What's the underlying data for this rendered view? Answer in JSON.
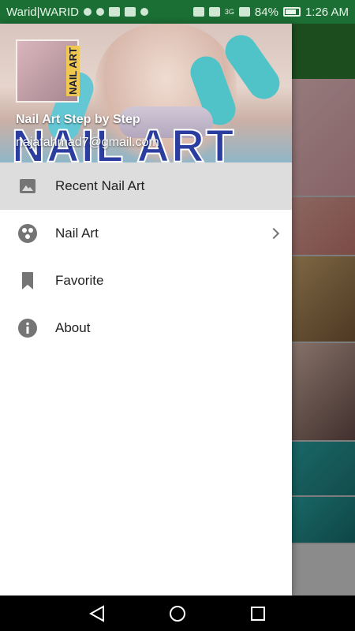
{
  "status_bar": {
    "carrier": "Warid|WARID",
    "network": "3G",
    "battery": "84%",
    "time": "1:26 AM"
  },
  "drawer": {
    "header": {
      "title": "Nail Art Step by Step",
      "email": "najafahmad7@gmail.com",
      "brand_text": "NAIL ART",
      "logo_text": "NAIL ART"
    },
    "items": [
      {
        "label": "Recent Nail Art",
        "icon": "image-icon",
        "active": true
      },
      {
        "label": "Nail Art",
        "icon": "palette-icon",
        "has_submenu": true
      },
      {
        "label": "Favorite",
        "icon": "bookmark-icon"
      },
      {
        "label": "About",
        "icon": "info-icon"
      }
    ]
  },
  "nav_bar": {
    "buttons": [
      "back-icon",
      "home-icon",
      "recents-icon"
    ]
  }
}
